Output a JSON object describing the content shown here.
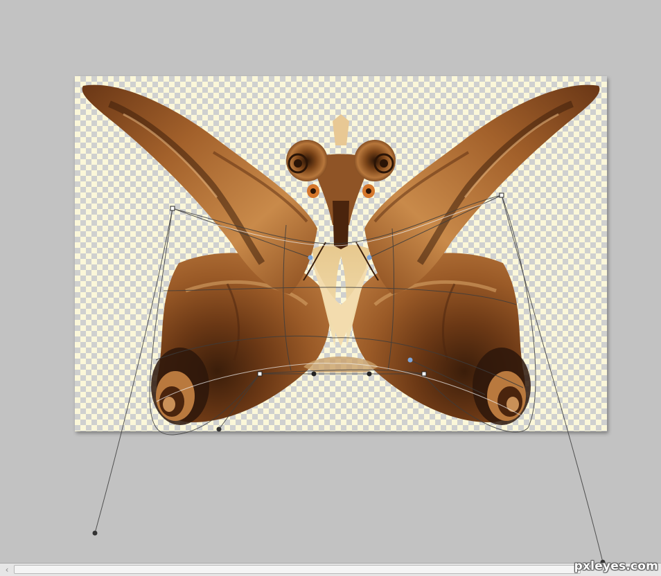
{
  "app": {
    "mode": "warp-transform"
  },
  "document": {
    "content": "moth-butterfly-composite-artwork",
    "background": "transparent-checkerboard"
  },
  "colors": {
    "workspace": "#c2c2c2",
    "checker_light": "#fbf7d9",
    "checker_dark": "#cfd0cf",
    "wing_dark": "#5a2f12",
    "wing_mid": "#9a5624",
    "wing_light": "#d89a55",
    "body_cream": "#f0d9a8",
    "control_handle_blue": "#7fa6d8"
  },
  "scrollbar": {
    "left_arrow": "‹"
  },
  "watermark": {
    "text": "pxleyes.com"
  }
}
